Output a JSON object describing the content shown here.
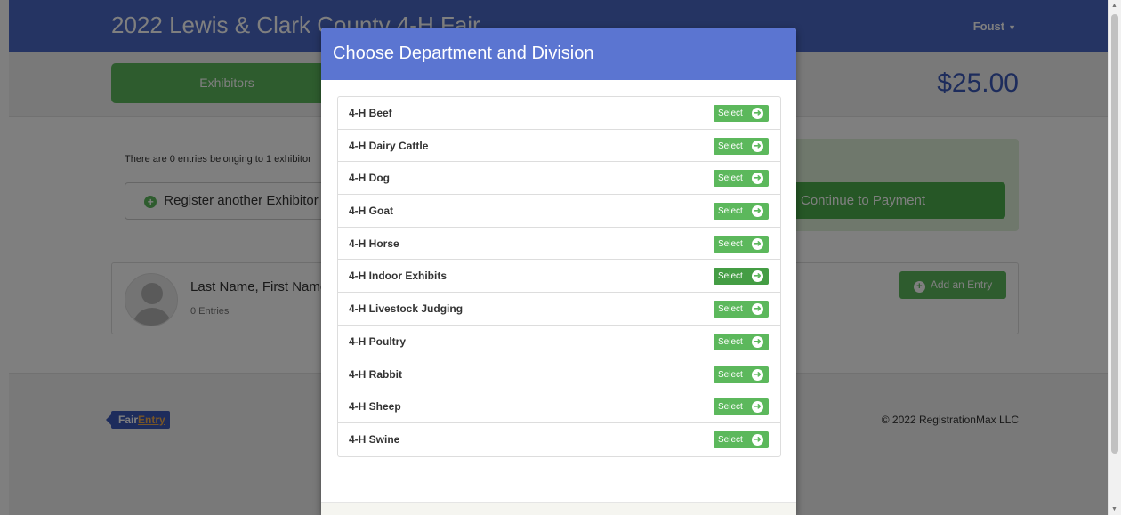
{
  "navbar": {
    "title": "2022 Lewis & Clark County 4-H Fair",
    "user": "Foust"
  },
  "subbar": {
    "tab_exhibitors": "Exhibitors",
    "total": "$25.00"
  },
  "content": {
    "entries_text": "There are 0 entries belonging to 1 exhibitor",
    "register_label": "Register another Exhibitor",
    "payment_label": "Continue to Payment"
  },
  "exhibitor": {
    "name": "Last Name, First Name",
    "entries": "0 Entries",
    "add_entry": "Add an Entry"
  },
  "footer": {
    "logo_fair": "Fair",
    "logo_entry": "Entry",
    "copyright": "© 2022 RegistrationMax LLC"
  },
  "modal": {
    "title": "Choose Department and Division",
    "select_label": "Select",
    "departments": [
      "4-H Beef",
      "4-H Dairy Cattle",
      "4-H Dog",
      "4-H Goat",
      "4-H Horse",
      "4-H Indoor Exhibits",
      "4-H Livestock Judging",
      "4-H Poultry",
      "4-H Rabbit",
      "4-H Sheep",
      "4-H Swine"
    ]
  },
  "colors": {
    "navbar": "#4b69c7",
    "modal_header": "#5b75d1",
    "success": "#5cb85c"
  }
}
